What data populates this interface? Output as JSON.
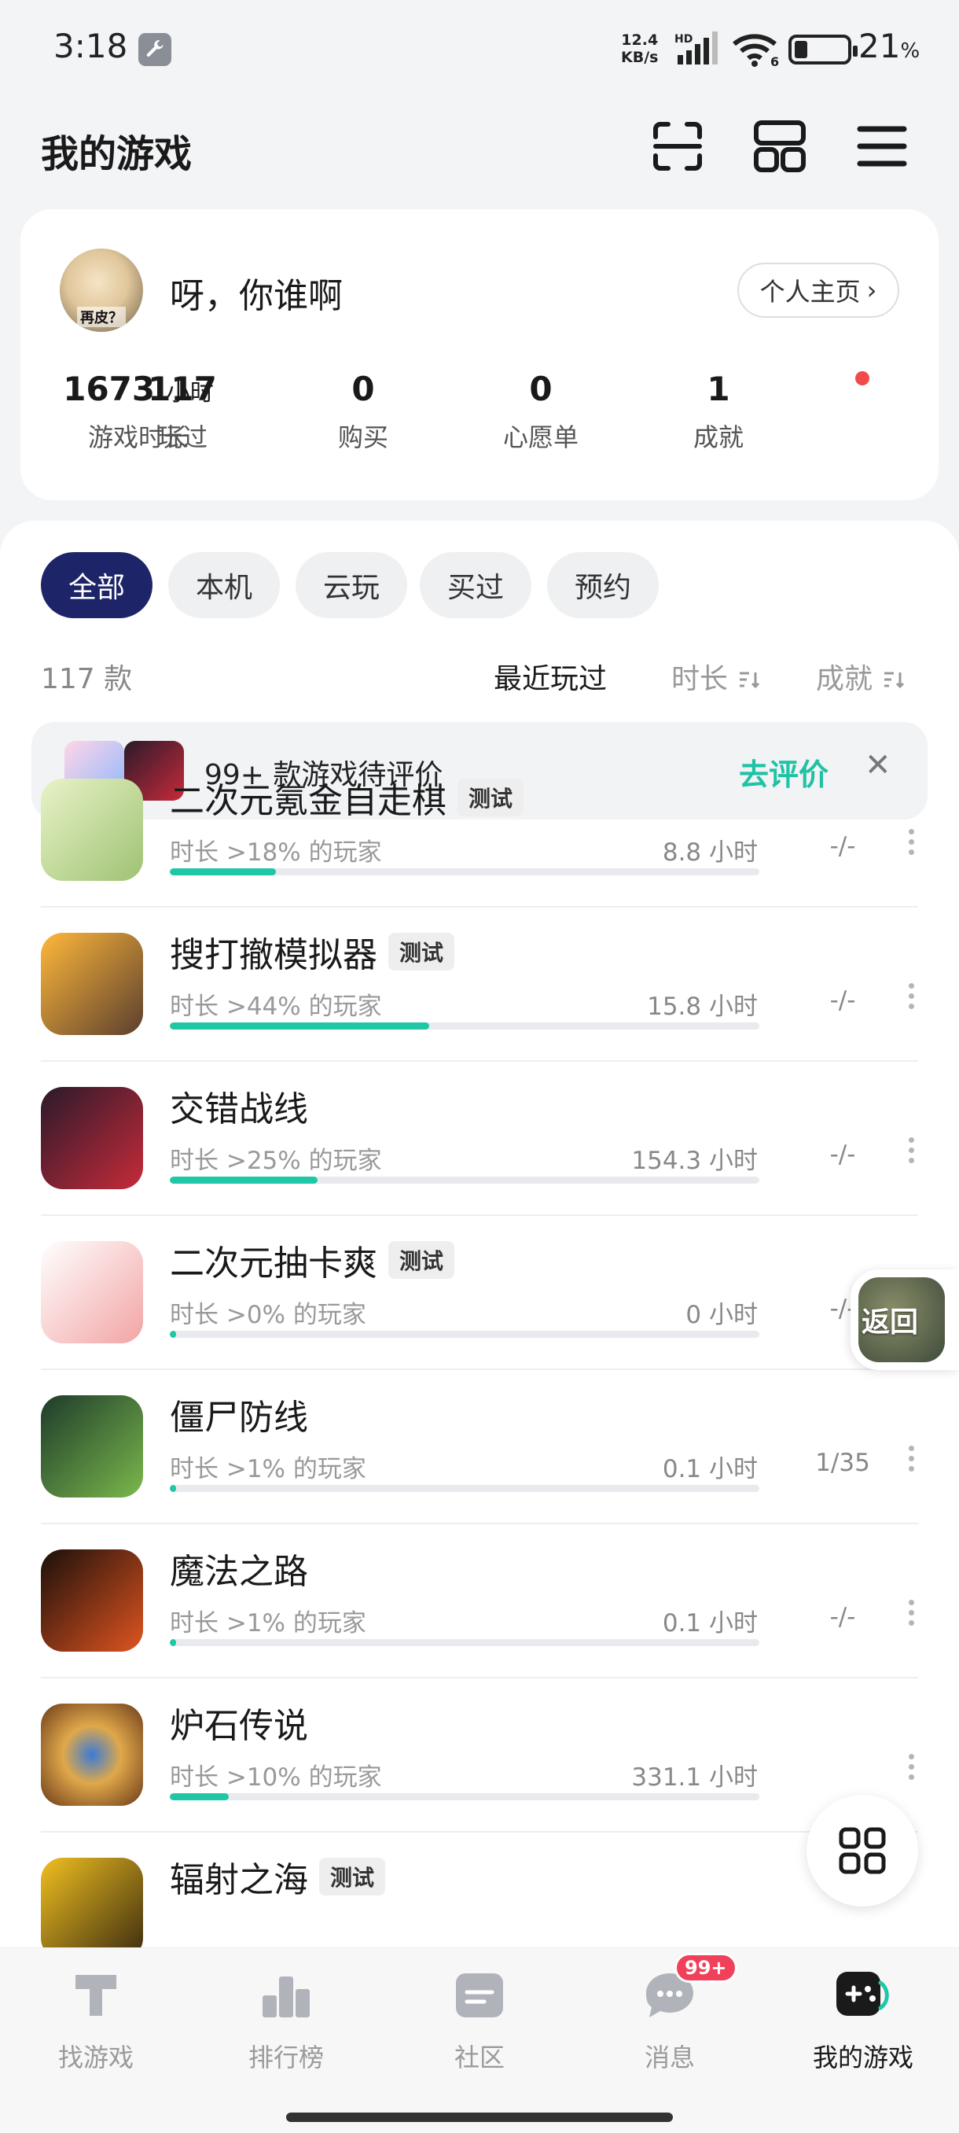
{
  "status": {
    "time": "3:18",
    "speed_value": "12.4",
    "speed_unit": "KB/s",
    "battery": "21",
    "battery_unit": "%"
  },
  "header": {
    "title": "我的游戏"
  },
  "profile": {
    "avatar_tag": "再皮？",
    "nickname": "呀，你谁啊",
    "homepage_label": "个人主页",
    "stats": [
      {
        "value": "1673",
        "unit": "小时",
        "label": "游戏时长"
      },
      {
        "value": "117",
        "unit": "",
        "label": "玩过"
      },
      {
        "value": "0",
        "unit": "",
        "label": "购买"
      },
      {
        "value": "0",
        "unit": "",
        "label": "心愿单"
      },
      {
        "value": "1",
        "unit": "",
        "label": "成就"
      }
    ]
  },
  "filters": [
    "全部",
    "本机",
    "云玩",
    "买过",
    "预约"
  ],
  "active_filter": "全部",
  "count": "117 款",
  "sort": {
    "recent": "最近玩过",
    "duration": "时长",
    "achievement": "成就"
  },
  "banner": {
    "text": "99+ 款游戏待评价",
    "action": "去评价"
  },
  "games": [
    {
      "name": "二次元氪金自走棋",
      "badge": "测试",
      "percent": "时长 >18% 的玩家",
      "ratio": 0.18,
      "hours": "8.8 小时",
      "achievement": "-/-"
    },
    {
      "name": "搜打撤模拟器",
      "badge": "测试",
      "percent": "时长 >44% 的玩家",
      "ratio": 0.44,
      "hours": "15.8 小时",
      "achievement": "-/-"
    },
    {
      "name": "交错战线",
      "badge": "",
      "percent": "时长 >25% 的玩家",
      "ratio": 0.25,
      "hours": "154.3 小时",
      "achievement": "-/-"
    },
    {
      "name": "二次元抽卡爽",
      "badge": "测试",
      "percent": "时长 >0% 的玩家",
      "ratio": 0.005,
      "hours": "0 小时",
      "achievement": "-/-"
    },
    {
      "name": "僵尸防线",
      "badge": "",
      "percent": "时长 >1% 的玩家",
      "ratio": 0.01,
      "hours": "0.1 小时",
      "achievement": "1/35"
    },
    {
      "name": "魔法之路",
      "badge": "",
      "percent": "时长 >1% 的玩家",
      "ratio": 0.01,
      "hours": "0.1 小时",
      "achievement": "-/-"
    },
    {
      "name": "炉石传说",
      "badge": "",
      "percent": "时长 >10% 的玩家",
      "ratio": 0.1,
      "hours": "331.1 小时",
      "achievement": ""
    },
    {
      "name": "辐射之海",
      "badge": "测试",
      "percent": "",
      "ratio": 0,
      "hours": "",
      "achievement": ""
    }
  ],
  "return_label": "返回",
  "nav": [
    {
      "label": "找游戏",
      "icon": "find-game-icon"
    },
    {
      "label": "排行榜",
      "icon": "ranking-icon"
    },
    {
      "label": "社区",
      "icon": "community-icon"
    },
    {
      "label": "消息",
      "icon": "message-icon",
      "badge": "99+"
    },
    {
      "label": "我的游戏",
      "icon": "my-games-icon"
    }
  ],
  "colors": {
    "accent": "#1fc7a6",
    "chip_active": "#1d2467",
    "notify": "#f04a4a"
  }
}
